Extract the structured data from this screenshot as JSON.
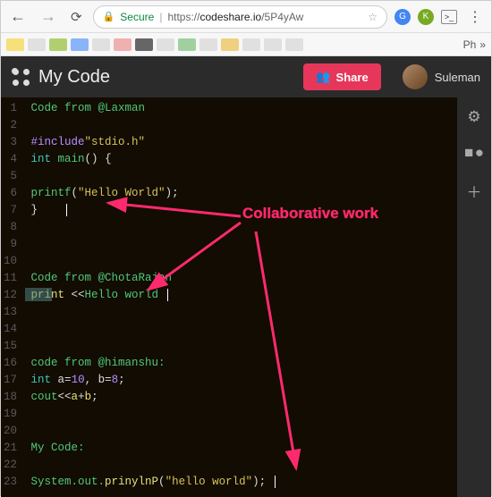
{
  "browser": {
    "secure_label": "Secure",
    "url_scheme": "https://",
    "url_host": "codeshare.io",
    "url_path": "/5P4yAw",
    "bookmark_more": "Ph"
  },
  "header": {
    "title": "My Code",
    "share_label": "Share",
    "username": "Suleman"
  },
  "annotation": "Collaborative work",
  "code": {
    "l1": {
      "a": "Code from @Laxman"
    },
    "l3": {
      "a": "#include",
      "b": "\"stdio.h\""
    },
    "l4": {
      "a": "int",
      "b": " main",
      "c": "()",
      "d": " {"
    },
    "l6": {
      "a": "printf",
      "b": "(",
      "c": "\"Hello World\"",
      "d": ");"
    },
    "l7": {
      "a": "}"
    },
    "l11": {
      "a": "Code from @ChotaRajan"
    },
    "l12": {
      "a": "print ",
      "b": "<<",
      "c": "Hello world"
    },
    "l16": {
      "a": "code from @himanshu:"
    },
    "l17": {
      "a": "int",
      "b": " a",
      "c": "=",
      "d": "10",
      "e": ", b",
      "f": "=",
      "g": "8",
      "h": ";"
    },
    "l18": {
      "a": "cout",
      "b": "<<",
      "c": "a",
      "d": "+",
      "e": "b",
      "f": ";"
    },
    "l21": {
      "a": "My Code:"
    },
    "l23": {
      "a": "System.out.",
      "b": "prinylnP",
      "c": "(",
      "d": "\"hello world\"",
      "e": ");"
    }
  }
}
